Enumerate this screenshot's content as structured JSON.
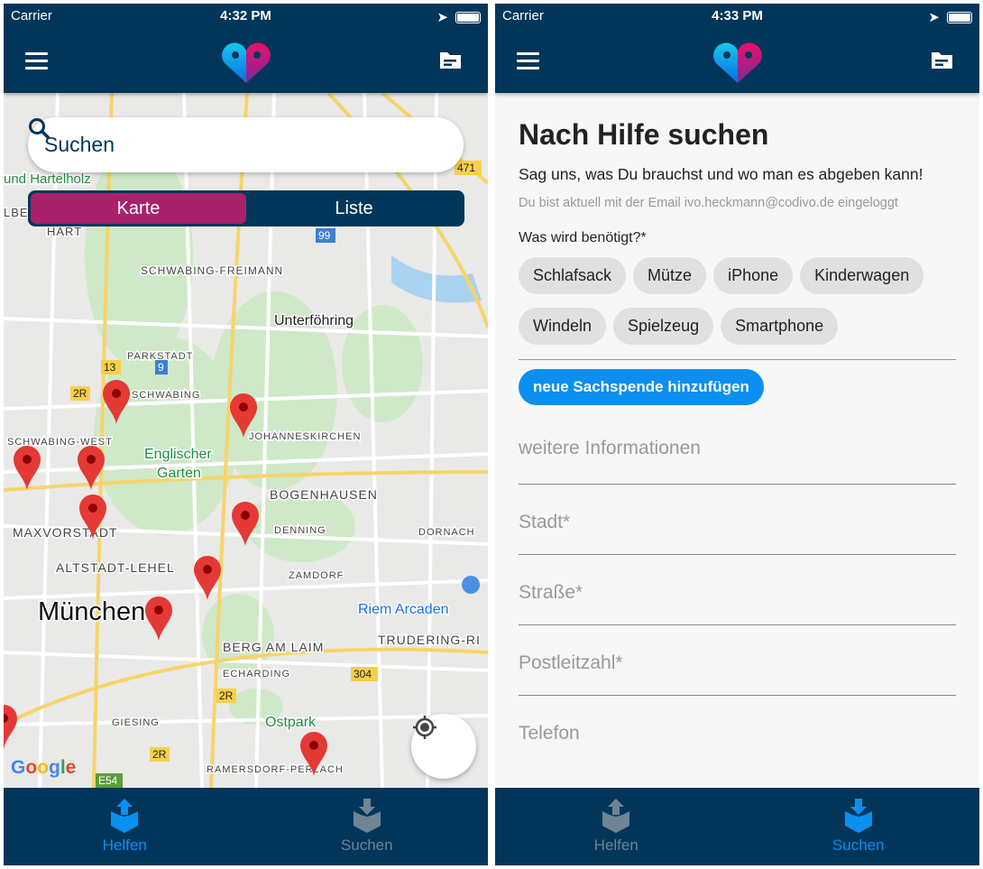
{
  "left": {
    "status": {
      "carrier": "Carrier",
      "time": "4:32 PM"
    },
    "search": {
      "placeholder": "Suchen",
      "icon": "search-icon"
    },
    "segment": {
      "tabs": [
        "Karte",
        "Liste"
      ],
      "active": "Karte"
    },
    "map": {
      "labels": [
        "und Hartelholz",
        "LBE",
        "HART",
        "SCHWABING-FREIMANN",
        "Unterföhring",
        "PARKSTADT",
        "SCHWABING",
        "SCHWABING-WEST",
        "Englischer",
        "Garten",
        "JOHANNESKIRCHEN",
        "BOGENHAUSEN",
        "MAXVORSTADT",
        "DENNING",
        "DORNACH",
        "ALTSTADT-LEHEL",
        "ZAMDORF",
        "München",
        "Riem Arcaden",
        "BERG AM LAIM",
        "TRUDERING-RI",
        "ECHARDING",
        "GIESING",
        "Ostpark",
        "RAMERSDORF-PERLACH"
      ],
      "road_badges": [
        "471",
        "99",
        "13",
        "9",
        "2R",
        "304",
        "2R",
        "2R",
        "E54"
      ],
      "attribution": "Google",
      "pin_color": "#e53935"
    },
    "tabbar": [
      {
        "label": "Helfen",
        "icon": "box-upload-icon",
        "active": true
      },
      {
        "label": "Suchen",
        "icon": "box-download-icon",
        "active": false
      }
    ]
  },
  "right": {
    "status": {
      "carrier": "Carrier",
      "time": "4:33 PM"
    },
    "title": "Nach Hilfe suchen",
    "subtitle": "Sag uns, was Du brauchst und wo man es abgeben kann!",
    "login_info": "Du bist aktuell mit der Email ivo.heckmann@codivo.de eingeloggt",
    "question": "Was wird benötigt?*",
    "chips": [
      "Schlafsack",
      "Mütze",
      "iPhone",
      "Kinderwagen",
      "Windeln",
      "Spielzeug",
      "Smartphone"
    ],
    "add_button": "neue Sachspende hinzufügen",
    "fields": [
      "weitere Informationen",
      "Stadt*",
      "Straße*",
      "Postleitzahl*",
      "Telefon"
    ],
    "tabbar": [
      {
        "label": "Helfen",
        "icon": "box-upload-icon",
        "active": false
      },
      {
        "label": "Suchen",
        "icon": "box-download-icon",
        "active": true
      }
    ]
  },
  "colors": {
    "navy": "#01365a",
    "accent": "#0b8ff0",
    "segment_active": "#a8216a"
  }
}
